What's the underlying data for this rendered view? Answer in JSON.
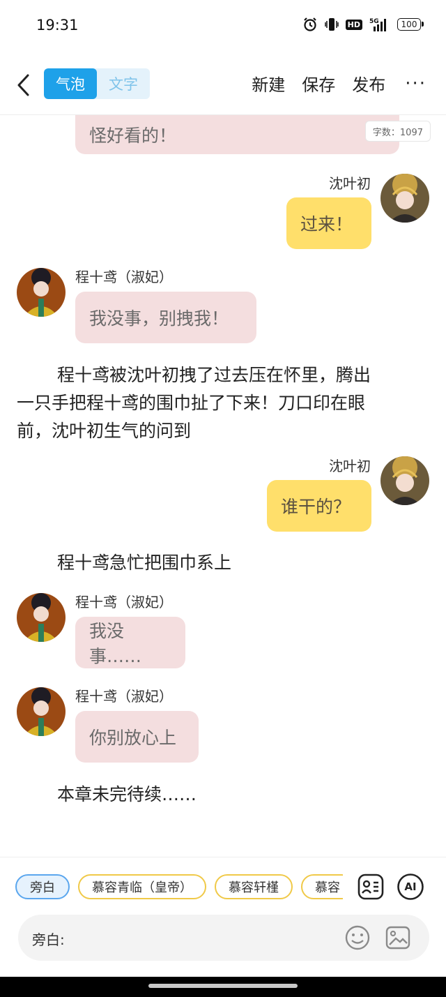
{
  "status_bar": {
    "time": "19:31",
    "hd": "HD",
    "network": "5G",
    "battery": "100"
  },
  "top_bar": {
    "tabs": [
      {
        "label": "气泡",
        "active": true
      },
      {
        "label": "文字",
        "active": false
      }
    ],
    "new_label": "新建",
    "save_label": "保存",
    "publish_label": "发布",
    "more_label": "···"
  },
  "word_count": "字数：1097",
  "messages": [
    {
      "type": "bubble",
      "side": "left",
      "color": "pink",
      "text": "怪好看的！"
    },
    {
      "type": "bubble",
      "side": "right",
      "speaker": "沈叶初",
      "color": "yellow",
      "text": "过来！"
    },
    {
      "type": "bubble",
      "side": "left",
      "speaker": "程十鸢（淑妃）",
      "color": "pink",
      "text": "我没事，别拽我！"
    },
    {
      "type": "narration",
      "lines": [
        "程十鸢被沈叶初拽了过去压在怀里，腾出",
        "一只手把程十鸢的围巾扯了下来！刀口印在眼",
        "前，沈叶初生气的问到"
      ]
    },
    {
      "type": "bubble",
      "side": "right",
      "speaker": "沈叶初",
      "color": "yellow",
      "text": "谁干的？"
    },
    {
      "type": "narration",
      "text": "程十鸢急忙把围巾系上"
    },
    {
      "type": "bubble",
      "side": "left",
      "speaker": "程十鸢（淑妃）",
      "color": "pink",
      "text": "我没事……"
    },
    {
      "type": "bubble",
      "side": "left",
      "speaker": "程十鸢（淑妃）",
      "color": "pink",
      "text": "你别放心上"
    },
    {
      "type": "narration",
      "text": "本章未完待续……"
    }
  ],
  "bottom_panel": {
    "chips": [
      "旁白",
      "慕容青临（皇帝）",
      "慕容轩槿",
      "慕容"
    ],
    "ai_label": "AI",
    "input_label": "旁白:"
  },
  "colors": {
    "accent_blue": "#1ea1e9",
    "bubble_pink": "#f4dedf",
    "bubble_yellow": "#ffdf6b",
    "chip_border": "#f0c948"
  }
}
